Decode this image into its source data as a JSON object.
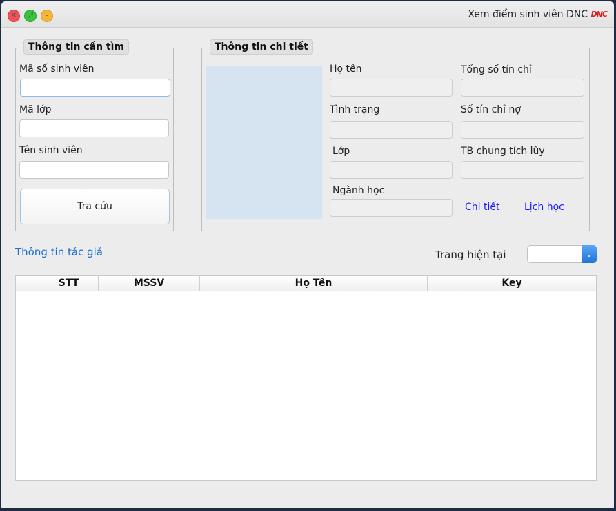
{
  "window": {
    "title": "Xem điểm sinh viên DNC",
    "logo_text": "DNC"
  },
  "search": {
    "group_title": "Thông tin cần tìm",
    "student_id_label": "Mã số sinh viên",
    "student_id_value": "",
    "class_label": "Mã lớp",
    "class_value": "",
    "name_label": "Tên sinh viên",
    "name_value": "",
    "search_button": "Tra cứu"
  },
  "details": {
    "group_title": "Thông tin chi tiết",
    "fullname_label": "Họ tên",
    "status_label": "Tình trạng",
    "class_label": "Lớp",
    "major_label": "Ngành học",
    "total_credits_label": "Tổng số tín chỉ",
    "owed_credits_label": "Số tín chỉ nợ",
    "gpa_label": "TB chung tích lũy",
    "detail_link": "Chi tiết",
    "schedule_link": "Lịch học"
  },
  "author_link": "Thông tin tác giả",
  "pager": {
    "label": "Trang hiện tại",
    "selected": ""
  },
  "grid": {
    "columns": [
      "",
      "STT",
      "MSSV",
      "Họ Tên",
      "Key"
    ],
    "rows": []
  }
}
